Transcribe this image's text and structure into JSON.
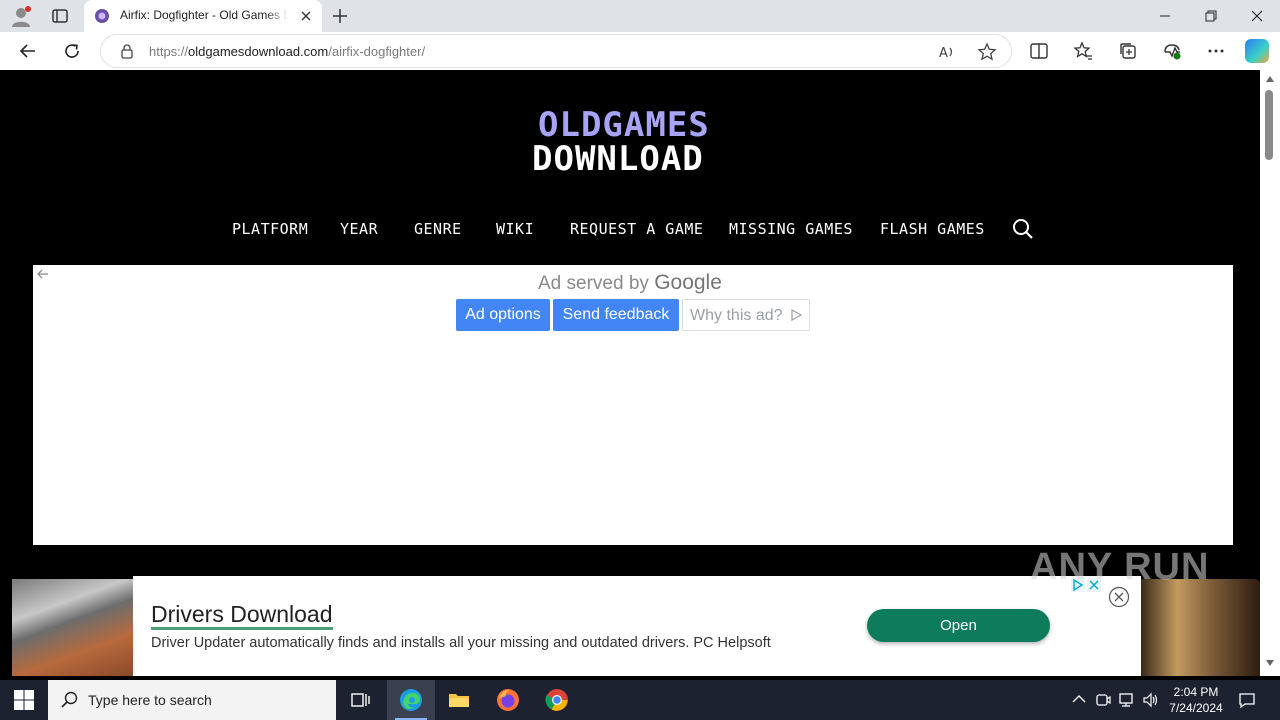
{
  "browser": {
    "tab_title": "Airfix: Dogfighter - Old Games Download",
    "url_scheme": "https://",
    "url_host": "oldgamesdownload.com",
    "url_path": "/airfix-dogfighter/"
  },
  "site": {
    "logo_line1": "OLDGAMES",
    "logo_line2": "DOWNLOAD",
    "menu": [
      "PLATFORM",
      "YEAR",
      "GENRE",
      "WIKI",
      "REQUEST A GAME",
      "MISSING GAMES",
      "FLASH GAMES"
    ]
  },
  "ad": {
    "served_by": "Ad served by",
    "google": "Google",
    "ad_options": "Ad options",
    "send_feedback": "Send feedback",
    "why_this_ad": "Why this ad?"
  },
  "banner": {
    "title": "Drivers Download",
    "description": "Driver Updater automatically finds and installs all your missing and outdated drivers. PC Helpsoft",
    "open_label": "Open"
  },
  "watermark": "ANY RUN",
  "taskbar": {
    "search_placeholder": "Type here to search",
    "time": "2:04 PM",
    "date": "7/24/2024"
  }
}
